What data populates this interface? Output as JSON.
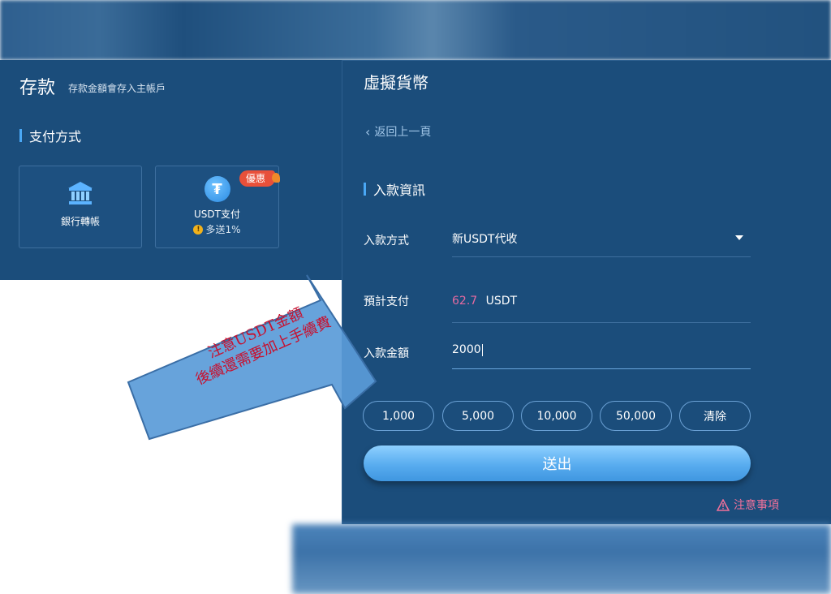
{
  "header": {
    "title": "存款",
    "subtitle": "存款金額會存入主帳戶"
  },
  "payment": {
    "section_title": "支付方式",
    "methods": [
      {
        "label": "銀行轉帳",
        "icon": "bank-icon"
      },
      {
        "label": "USDT支付",
        "icon": "tether-icon",
        "badge": "優惠",
        "bonus": "多送1%"
      }
    ]
  },
  "crypto": {
    "page_title": "虛擬貨幣",
    "back_label": "返回上一頁",
    "section_title": "入款資訊",
    "method_label": "入款方式",
    "method_value": "新USDT代收",
    "estimate_label": "預計支付",
    "estimate_amount": "62.7",
    "estimate_unit": "USDT",
    "amount_label": "入款金額",
    "amount_value": "2000",
    "quick_amounts": [
      "1,000",
      "5,000",
      "10,000",
      "50,000"
    ],
    "clear_label": "清除",
    "submit_label": "送出",
    "notice_label": "注意事項"
  },
  "annotation": {
    "line1": "注意USDT金額",
    "line2": "後續還需要加上手續費"
  },
  "colors": {
    "panel": "#1b4d7b",
    "accent": "#4aa8f5",
    "estimate": "#e46aa0",
    "notice": "#f0709a",
    "annotation_text": "#c8102e",
    "arrow_fill": "#5a9bd8"
  }
}
